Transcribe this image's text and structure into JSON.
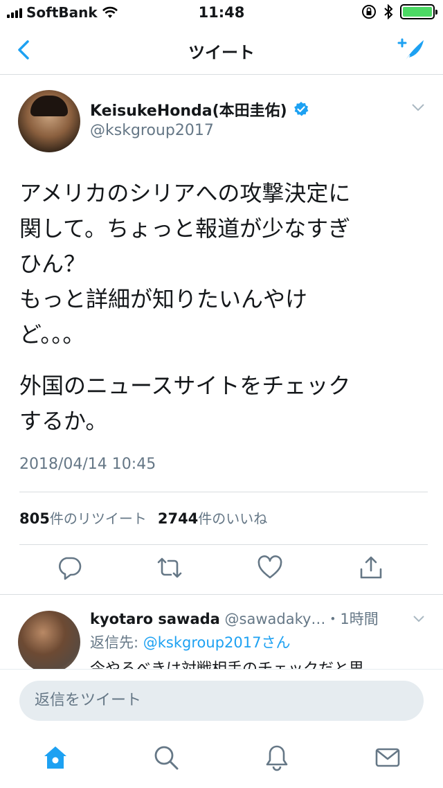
{
  "status_bar": {
    "carrier": "SoftBank",
    "time": "11:48"
  },
  "nav": {
    "title": "ツイート"
  },
  "tweet": {
    "display_name": "KeisukeHonda(本田圭佑)",
    "handle": "@kskgroup2017",
    "paragraph_1": "アメリカのシリアへの攻撃決定に\n関して。ちょっと報道が少なすぎ\nひん？\nもっと詳細が知りたいんやけ\nど。。。",
    "paragraph_2": "外国のニュースサイトをチェック\nするか。",
    "timestamp": "2018/04/14 10:45",
    "retweet_count": "805",
    "retweet_label": "件のリツイート",
    "like_count": "2744",
    "like_label": "件のいいね"
  },
  "reply": {
    "name": "kyotaro sawada",
    "handle_time": " @sawadaky…・1時間",
    "reply_to_label": "返信先: ",
    "reply_to_link": "@kskgroup2017さん",
    "text": "今やるべきは対戦相手のチェックだと思"
  },
  "reply_bar": {
    "placeholder": "返信をツイート"
  },
  "colors": {
    "accent": "#1da1f2",
    "secondary_text": "#657786",
    "battery": "#4cd964"
  },
  "icons": {
    "back": "chevron-left-icon",
    "compose": "compose-tweet-icon",
    "verified": "verified-badge-icon",
    "reply": "reply-icon",
    "retweet": "retweet-icon",
    "like": "heart-icon",
    "share": "share-icon",
    "home": "home-icon",
    "search": "search-icon",
    "notifications": "bell-icon",
    "messages": "envelope-icon"
  }
}
